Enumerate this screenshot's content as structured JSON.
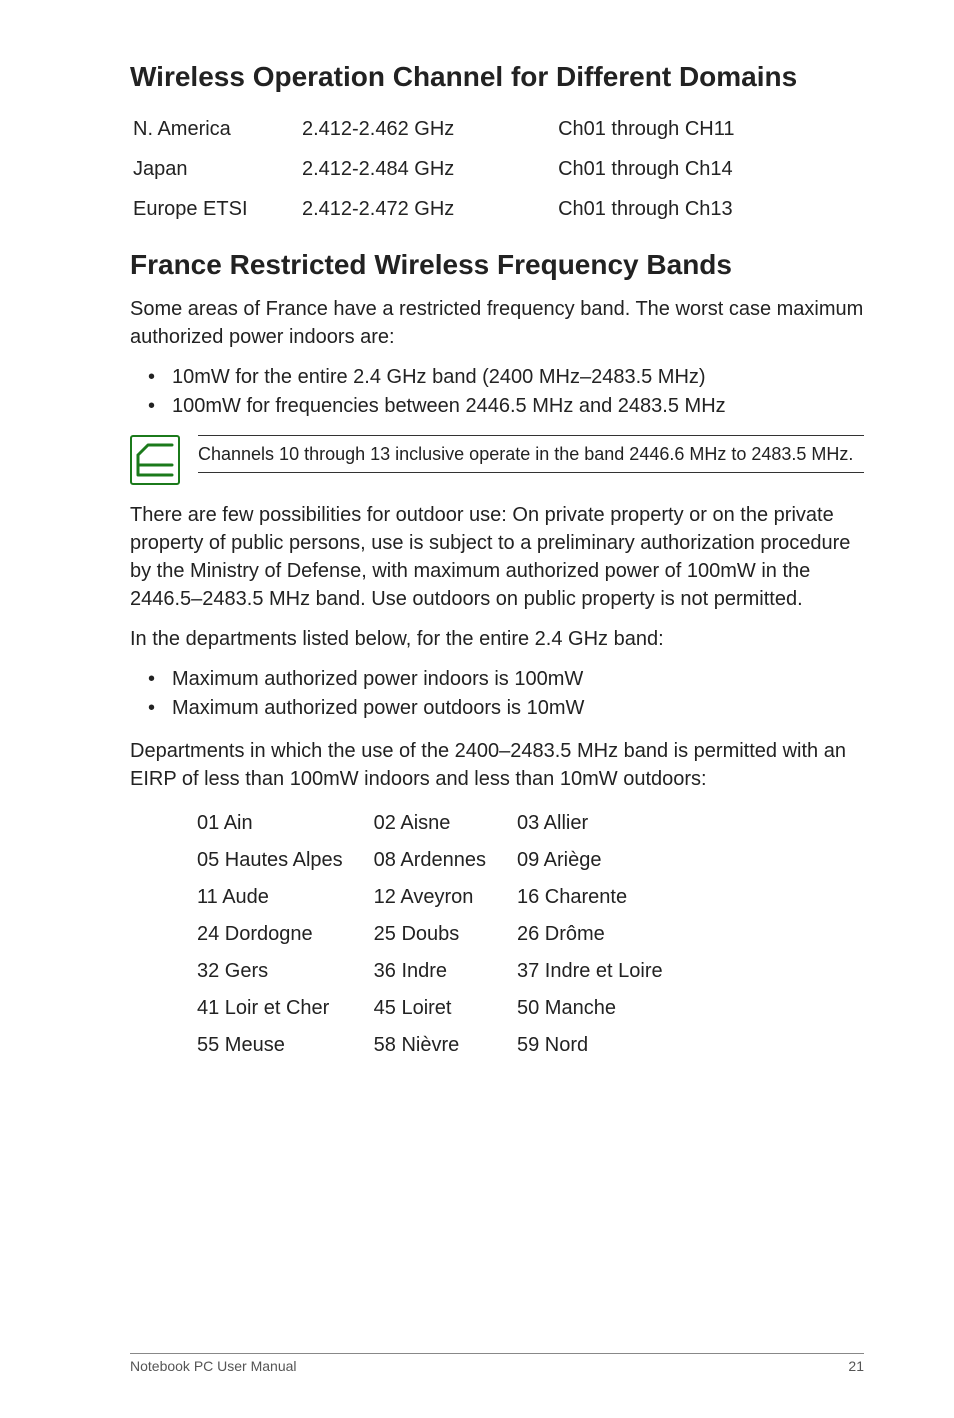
{
  "headings": {
    "channels": "Wireless Operation Channel for Different Domains",
    "france": "France Restricted Wireless Frequency Bands"
  },
  "channel_table": [
    {
      "region": "N. America",
      "freq": "2.412-2.462 GHz",
      "ch": "Ch01 through CH11"
    },
    {
      "region": "Japan",
      "freq": "2.412-2.484 GHz",
      "ch": "Ch01 through Ch14"
    },
    {
      "region": "Europe ETSI",
      "freq": "2.412-2.472 GHz",
      "ch": "Ch01 through Ch13"
    }
  ],
  "france_intro": "Some areas of France have a restricted frequency band. The worst case maximum authorized power indoors are:",
  "france_list1": [
    "10mW for the entire 2.4 GHz band (2400 MHz–2483.5 MHz)",
    "100mW for frequencies between 2446.5 MHz and 2483.5 MHz"
  ],
  "note": "Channels 10 through 13 inclusive operate in the band 2446.6 MHz to 2483.5 MHz.",
  "outdoor_para": "There are few possibilities for outdoor use: On private property or on the private property of public persons, use is subject to a preliminary authorization procedure by the Ministry of Defense, with maximum authorized power of 100mW in the 2446.5–2483.5 MHz band. Use outdoors on public property is not permitted.",
  "dept_intro": "In the departments listed below, for the entire 2.4 GHz band:",
  "france_list2": [
    "Maximum authorized power indoors is 100mW",
    "Maximum authorized power outdoors is 10mW"
  ],
  "dept_para": "Departments in which the use of the 2400–2483.5 MHz band is permitted with an EIRP of less than 100mW indoors and less than 10mW outdoors:",
  "departments": [
    [
      "01  Ain",
      "02  Aisne",
      "03  Allier"
    ],
    [
      "05  Hautes Alpes",
      "08  Ardennes",
      "09  Ariège"
    ],
    [
      "11  Aude",
      "12  Aveyron",
      "16  Charente"
    ],
    [
      "24  Dordogne",
      "25  Doubs",
      "26  Drôme"
    ],
    [
      "32  Gers",
      "36  Indre",
      "37  Indre et Loire"
    ],
    [
      "41  Loir et Cher",
      "45  Loiret",
      "50  Manche"
    ],
    [
      "55  Meuse",
      "58  Nièvre",
      "59  Nord"
    ]
  ],
  "footer": {
    "left": "Notebook PC User Manual",
    "right": "21"
  }
}
